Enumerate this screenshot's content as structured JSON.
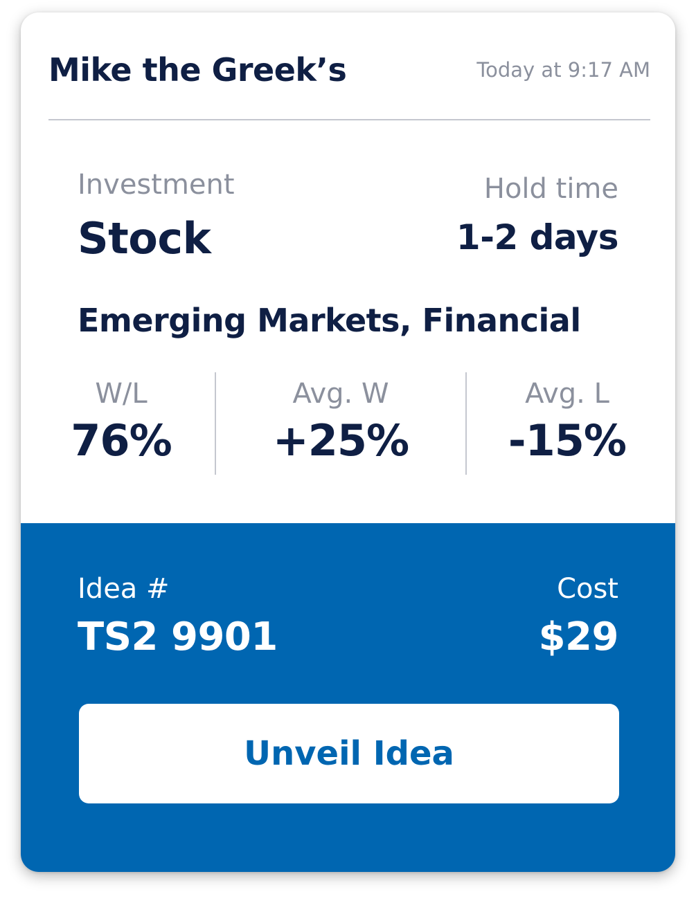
{
  "header": {
    "author": "Mike the Greek’s",
    "timestamp": "Today at 9:17 AM"
  },
  "investment": {
    "label": "Investment",
    "value": "Stock"
  },
  "hold_time": {
    "label": "Hold time",
    "value": "1-2 days"
  },
  "sectors": "Emerging Markets, Financial",
  "stats": [
    {
      "label": "W/L",
      "value": "76%"
    },
    {
      "label": "Avg. W",
      "value": "+25%"
    },
    {
      "label": "Avg. L",
      "value": "-15%"
    }
  ],
  "idea": {
    "label": "Idea #",
    "value": "TS2 9901"
  },
  "cost": {
    "label": "Cost",
    "value": "$29"
  },
  "button": {
    "label": "Unveil Idea"
  },
  "colors": {
    "primary": "#0066b1",
    "text_dark": "#0f1f44",
    "text_muted": "#8b909d"
  }
}
